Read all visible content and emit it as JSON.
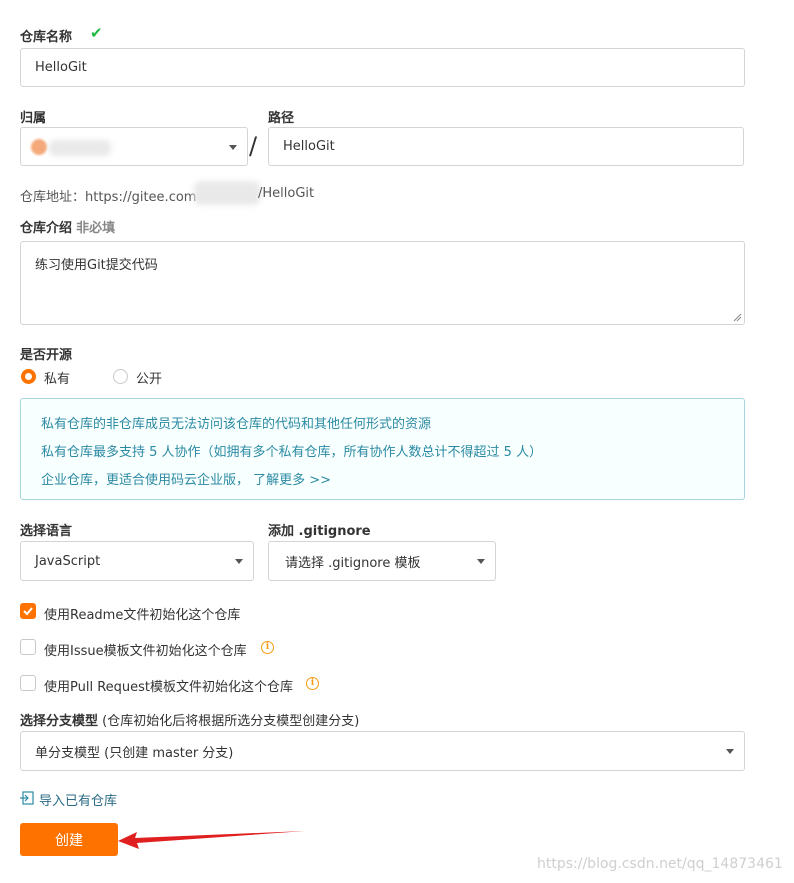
{
  "repo_name": {
    "label": "仓库名称",
    "value": "HelloGit"
  },
  "owner": {
    "label": "归属"
  },
  "path": {
    "label": "路径",
    "separator": "/",
    "value": "HelloGit"
  },
  "repo_url": {
    "prefix": "仓库地址：https://gitee.com",
    "suffix": "/HelloGit"
  },
  "intro": {
    "label": "仓库介绍",
    "optional": "非必填",
    "value": "练习使用Git提交代码"
  },
  "visibility": {
    "label": "是否开源",
    "options": [
      {
        "label": "私有",
        "selected": true
      },
      {
        "label": "公开",
        "selected": false
      }
    ]
  },
  "notice": {
    "lines": [
      "私有仓库的非仓库成员无法访问该仓库的代码和其他任何形式的资源",
      "私有仓库最多支持 5 人协作（如拥有多个私有仓库，所有协作人数总计不得超过 5 人）",
      "企业仓库，更适合使用码云企业版， 了解更多 >>"
    ]
  },
  "language": {
    "label": "选择语言",
    "value": "JavaScript"
  },
  "gitignore": {
    "label": "添加 .gitignore",
    "value": "请选择 .gitignore 模板"
  },
  "init_options": [
    {
      "label": "使用Readme文件初始化这个仓库",
      "checked": true,
      "info": false
    },
    {
      "label": "使用Issue模板文件初始化这个仓库",
      "checked": false,
      "info": true
    },
    {
      "label": "使用Pull Request模板文件初始化这个仓库",
      "checked": false,
      "info": true
    }
  ],
  "branch_model": {
    "label": "选择分支模型",
    "hint": "(仓库初始化后将根据所选分支模型创建分支)",
    "value": "单分支模型 (只创建 master 分支)"
  },
  "import_link": "导入已有仓库",
  "create_button": "创建",
  "watermark": "https://blog.csdn.net/qq_14873461",
  "colors": {
    "accent": "#fe7300",
    "notice_text": "#2b8aa3",
    "notice_border": "#a9d5de",
    "check_green": "#21ba45",
    "arrow_red": "#e02020"
  }
}
